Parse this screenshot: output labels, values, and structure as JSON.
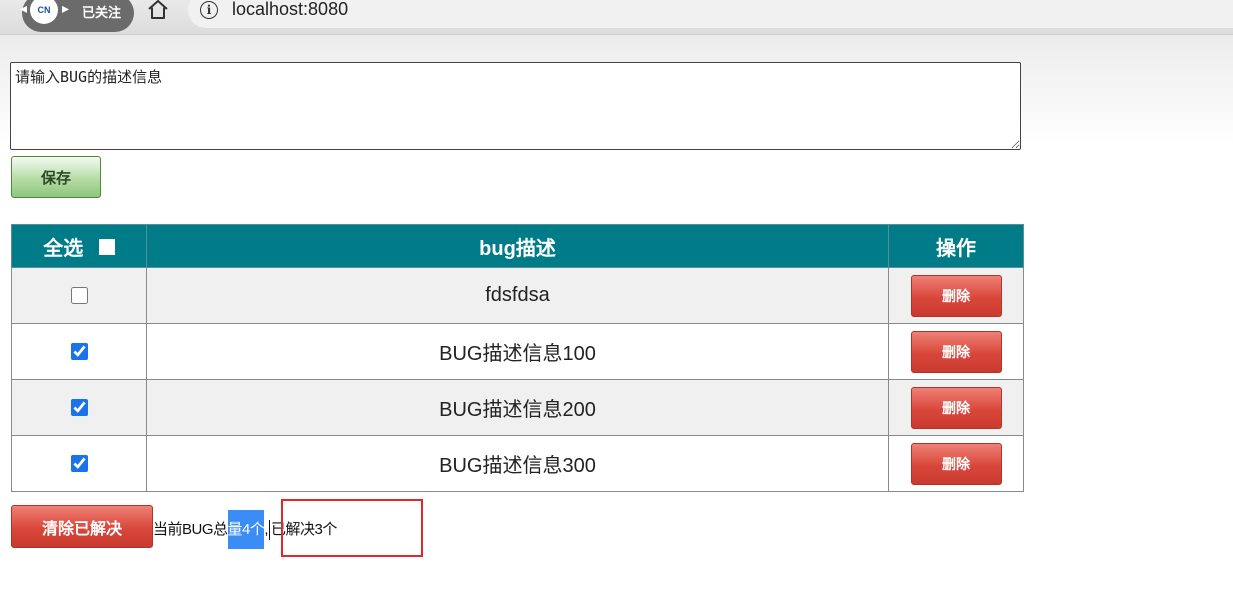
{
  "browser": {
    "follow_badge": "已关注",
    "logo_text": "CN",
    "url": "localhost:8080"
  },
  "form": {
    "description_placeholder": "请输入BUG的描述信息",
    "save_label": "保存"
  },
  "table": {
    "headers": {
      "select_all": "全选",
      "description": "bug描述",
      "action": "操作"
    },
    "rows": [
      {
        "checked": false,
        "description": "fdsfdsa",
        "delete_label": "删除"
      },
      {
        "checked": true,
        "description": "BUG描述信息100",
        "delete_label": "删除"
      },
      {
        "checked": true,
        "description": "BUG描述信息200",
        "delete_label": "删除"
      },
      {
        "checked": true,
        "description": "BUG描述信息300",
        "delete_label": "删除"
      }
    ]
  },
  "footer": {
    "clear_label": "清除已解决",
    "summary_prefix": "当前BUG总",
    "summary_highlight": "量4个",
    "summary_sep": ",",
    "summary_resolved": "已解决3个"
  },
  "colors": {
    "header_bg": "#007b88",
    "delete_red": "#d9473b",
    "save_green": "#8ec57c",
    "highlight": "#3a8df5",
    "annotation_box": "#e02a2a"
  }
}
